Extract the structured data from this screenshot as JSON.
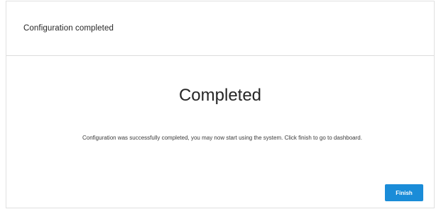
{
  "dialog": {
    "title": "Configuration completed",
    "heading": "Completed",
    "message": "Configuration was successfully completed, you may now start using the system. Click finish to go to dashboard.",
    "finish_label": "Finish"
  },
  "colors": {
    "accent": "#1a8cd8",
    "border": "#dcdcdc",
    "text": "#262626"
  }
}
